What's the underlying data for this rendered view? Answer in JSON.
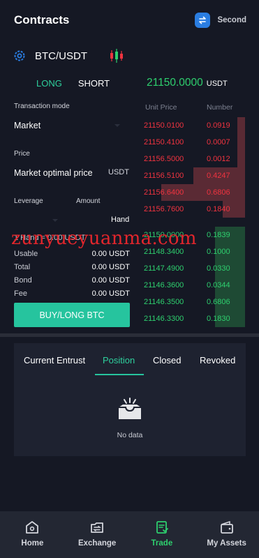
{
  "header": {
    "title": "Contracts",
    "second_label": "Second"
  },
  "pair": {
    "symbol": "BTC/USDT"
  },
  "side_tabs": {
    "long": "LONG",
    "short": "SHORT"
  },
  "last_price": {
    "value": "21150.0000",
    "unit": "USDT"
  },
  "form": {
    "mode_label": "Transaction mode",
    "mode_value": "Market",
    "price_label": "Price",
    "price_value": "Market optimal price",
    "price_unit": "USDT",
    "leverage_label": "Leverage",
    "amount_label": "Amount",
    "amount_unit": "Hand",
    "hand_info": "1 Hand = 0.00 USDT",
    "summary": [
      {
        "label": "Usable",
        "value": "0.00 USDT"
      },
      {
        "label": "Total",
        "value": "0.00 USDT"
      },
      {
        "label": "Bond",
        "value": "0.00 USDT"
      },
      {
        "label": "Fee",
        "value": "0.00 USDT"
      }
    ],
    "buy_button": "BUY/LONG BTC"
  },
  "watermark": "zunyueyuanma.com",
  "order_book": {
    "headers": {
      "price": "Unit Price",
      "number": "Number"
    },
    "asks": [
      {
        "price": "21150.0100",
        "number": "0.0919",
        "depth": 0.09
      },
      {
        "price": "21150.4100",
        "number": "0.0007",
        "depth": 0.09
      },
      {
        "price": "21156.5000",
        "number": "0.0012",
        "depth": 0.09
      },
      {
        "price": "21156.5100",
        "number": "0.4247",
        "depth": 0.62
      },
      {
        "price": "21156.6400",
        "number": "0.6806",
        "depth": 1.0
      },
      {
        "price": "21156.7600",
        "number": "0.1840",
        "depth": 0.27
      }
    ],
    "bids": [
      {
        "price": "21150.0000",
        "number": "0.1839",
        "depth": 0.36
      },
      {
        "price": "21148.3400",
        "number": "0.1000",
        "depth": 0.36
      },
      {
        "price": "21147.4900",
        "number": "0.0330",
        "depth": 0.36
      },
      {
        "price": "21146.3600",
        "number": "0.0344",
        "depth": 0.36
      },
      {
        "price": "21146.3500",
        "number": "0.6806",
        "depth": 0.36
      },
      {
        "price": "21146.3300",
        "number": "0.1830",
        "depth": 0.36
      }
    ]
  },
  "orders": {
    "tabs": [
      "Current Entrust",
      "Position",
      "Closed",
      "Revoked"
    ],
    "active_tab": 1,
    "empty_text": "No data"
  },
  "bottom_nav": [
    {
      "label": "Home",
      "icon": "home-icon"
    },
    {
      "label": "Exchange",
      "icon": "exchange-icon"
    },
    {
      "label": "Trade",
      "icon": "trade-icon"
    },
    {
      "label": "My Assets",
      "icon": "wallet-icon"
    }
  ],
  "colors": {
    "accent": "#26c49e",
    "up": "#2ecf6e",
    "down": "#f0333f",
    "background": "#151824"
  }
}
